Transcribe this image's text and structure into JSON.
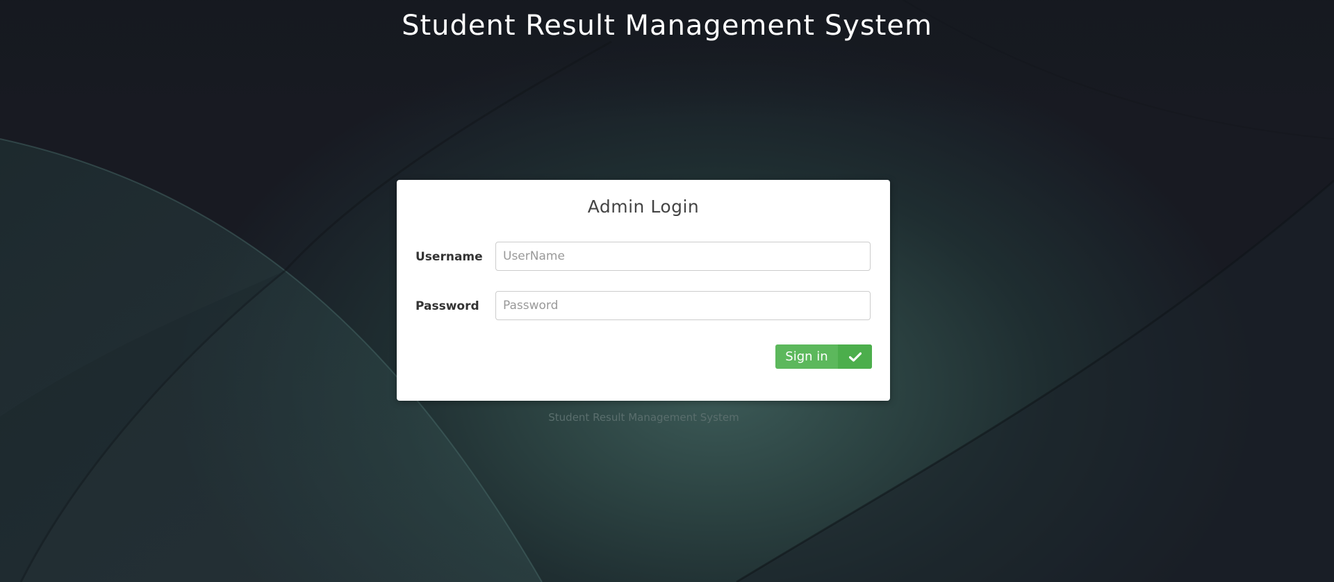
{
  "page": {
    "title": "Student Result Management System",
    "footer": "Student Result Management System"
  },
  "login": {
    "heading": "Admin Login",
    "username_label": "Username",
    "username_placeholder": "UserName",
    "username_value": "",
    "password_label": "Password",
    "password_placeholder": "Password",
    "password_value": "",
    "submit_label": "Sign in",
    "submit_icon": "check-icon"
  },
  "colors": {
    "button": "#5cb85c",
    "button_icon_bg": "#4cae4c",
    "panel": "#ffffff"
  }
}
